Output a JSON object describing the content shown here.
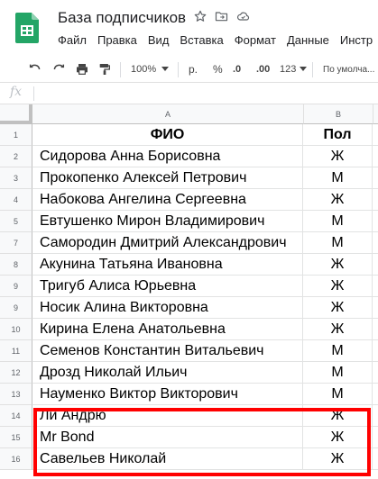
{
  "app": {
    "title": "База подписчиков",
    "menu": [
      "Файл",
      "Правка",
      "Вид",
      "Вставка",
      "Формат",
      "Данные",
      "Инстр"
    ]
  },
  "toolbar": {
    "zoom": "100%",
    "currency": "р.",
    "percent": "%",
    "decrease_decimals": ".0",
    "increase_decimals": ".00",
    "more_formats": "123",
    "font": "По умолча..."
  },
  "formula_bar": {
    "fx": "fx"
  },
  "columns": [
    "A",
    "B"
  ],
  "rows": [
    {
      "num": "1",
      "a": "ФИО",
      "b": "Пол"
    },
    {
      "num": "2",
      "a": "Сидорова Анна Борисовна",
      "b": "Ж"
    },
    {
      "num": "3",
      "a": "Прокопенко Алексей Петрович",
      "b": "М"
    },
    {
      "num": "4",
      "a": "Набокова Ангелина Сергеевна",
      "b": "Ж"
    },
    {
      "num": "5",
      "a": "Евтушенко Мирон Владимирович",
      "b": "М"
    },
    {
      "num": "7",
      "a": "Самородин Дмитрий Александрович",
      "b": "М"
    },
    {
      "num": "8",
      "a": "Акунина Татьяна Ивановна",
      "b": "Ж"
    },
    {
      "num": "9",
      "a": "Тригуб Алиса Юрьевна",
      "b": "Ж"
    },
    {
      "num": "9",
      "a": "Носик Алина Викторовна",
      "b": "Ж"
    },
    {
      "num": "10",
      "a": "Кирина Елена Анатольевна",
      "b": "Ж"
    },
    {
      "num": "11",
      "a": "Семенов Константин Витальевич",
      "b": "М"
    },
    {
      "num": "12",
      "a": "Дрозд Николай Ильич",
      "b": "М"
    },
    {
      "num": "13",
      "a": "Науменко Виктор Викторович",
      "b": "М"
    },
    {
      "num": "14",
      "a": "Ли Андрю",
      "b": "Ж"
    },
    {
      "num": "15",
      "a": "Mr Bond",
      "b": "Ж"
    },
    {
      "num": "16",
      "a": "Савельев Николай",
      "b": "Ж"
    }
  ],
  "colors": {
    "highlight": "#ff0000",
    "sheets_green": "#0f9d58"
  }
}
